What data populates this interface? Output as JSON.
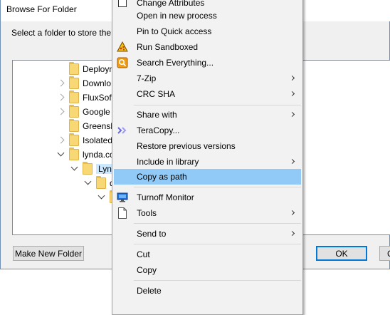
{
  "dialog": {
    "title": "Browse For Folder",
    "instruction": "Select a folder to store the do",
    "tree": [
      {
        "label": "Deploym",
        "expander": "none"
      },
      {
        "label": "Downlo",
        "expander": "right"
      },
      {
        "label": "FluxSoft",
        "expander": "right"
      },
      {
        "label": "Google",
        "expander": "right"
      },
      {
        "label": "Greensh",
        "expander": "none"
      },
      {
        "label": "Isolated",
        "expander": "right"
      },
      {
        "label": "lynda.co",
        "expander": "down"
      },
      {
        "label": "Lynd",
        "expander": "down"
      },
      {
        "label": "d",
        "expander": "down"
      },
      {
        "label": "",
        "expander": "down"
      }
    ],
    "buttons": {
      "new_folder": "Make New Folder",
      "ok": "OK",
      "cancel": "C"
    }
  },
  "context_menu": {
    "items": [
      {
        "label": "Change Attributes",
        "icon": "checkbox-icon",
        "submenu": false
      },
      {
        "label": "Open in new process",
        "icon": "",
        "submenu": false
      },
      {
        "label": "Pin to Quick access",
        "icon": "",
        "submenu": false
      },
      {
        "label": "Run Sandboxed",
        "icon": "sandboxie-icon",
        "submenu": false
      },
      {
        "label": "Search Everything...",
        "icon": "search-everything-icon",
        "submenu": false
      },
      {
        "label": "7-Zip",
        "icon": "",
        "submenu": true
      },
      {
        "label": "CRC SHA",
        "icon": "",
        "submenu": true
      },
      {
        "label": "Share with",
        "icon": "",
        "submenu": true
      },
      {
        "label": "TeraCopy...",
        "icon": "teracopy-icon",
        "submenu": false
      },
      {
        "label": "Restore previous versions",
        "icon": "",
        "submenu": false
      },
      {
        "label": "Include in library",
        "icon": "",
        "submenu": true
      },
      {
        "label": "Copy as path",
        "icon": "",
        "submenu": false,
        "highlighted": true
      },
      {
        "label": "Turnoff Monitor",
        "icon": "monitor-icon",
        "submenu": false
      },
      {
        "label": "Tools",
        "icon": "document-icon",
        "submenu": true
      },
      {
        "label": "Send to",
        "icon": "",
        "submenu": true
      },
      {
        "label": "Cut",
        "icon": "",
        "submenu": false
      },
      {
        "label": "Copy",
        "icon": "",
        "submenu": false
      },
      {
        "label": "Delete",
        "icon": "",
        "submenu": false
      }
    ]
  },
  "colors": {
    "highlight": "#91c9f7",
    "selected_tree_item": "#cce8ff",
    "default_button_border": "#0078d7"
  }
}
